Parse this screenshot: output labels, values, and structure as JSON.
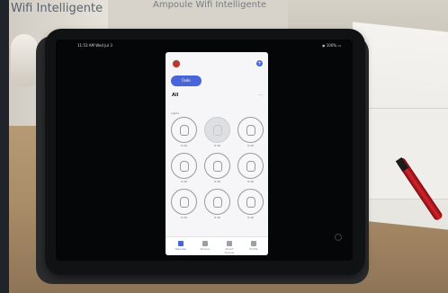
{
  "background": {
    "box_text": "Wifi Intelligente",
    "box_top_text": "Ampoule Wifi Intelligente"
  },
  "tablet": {
    "status_time": "11:53 AM   Wed Jul 3",
    "status_right": "◉ 100% ▭"
  },
  "app": {
    "accent": "#4866d8",
    "add_label": "+",
    "pill_label": "Fade",
    "section_title": "All",
    "menu": "…",
    "group_label": "Lights",
    "lights": [
      {
        "name": "S 10",
        "on": true
      },
      {
        "name": "S 10",
        "on": false
      },
      {
        "name": "S 10",
        "on": true
      },
      {
        "name": "S 10",
        "on": true
      },
      {
        "name": "S 10",
        "on": true
      },
      {
        "name": "S 10",
        "on": true
      },
      {
        "name": "S 10",
        "on": true
      },
      {
        "name": "S 10",
        "on": true
      },
      {
        "name": "S 10",
        "on": true
      }
    ],
    "tabs": [
      {
        "label": "Devices",
        "icon": "grid-icon",
        "active": true
      },
      {
        "label": "Rooms",
        "icon": "home-icon",
        "active": false
      },
      {
        "label": "Smart Scenes",
        "icon": "scenes-icon",
        "active": false
      },
      {
        "label": "Profile",
        "icon": "profile-icon",
        "active": false
      }
    ]
  }
}
